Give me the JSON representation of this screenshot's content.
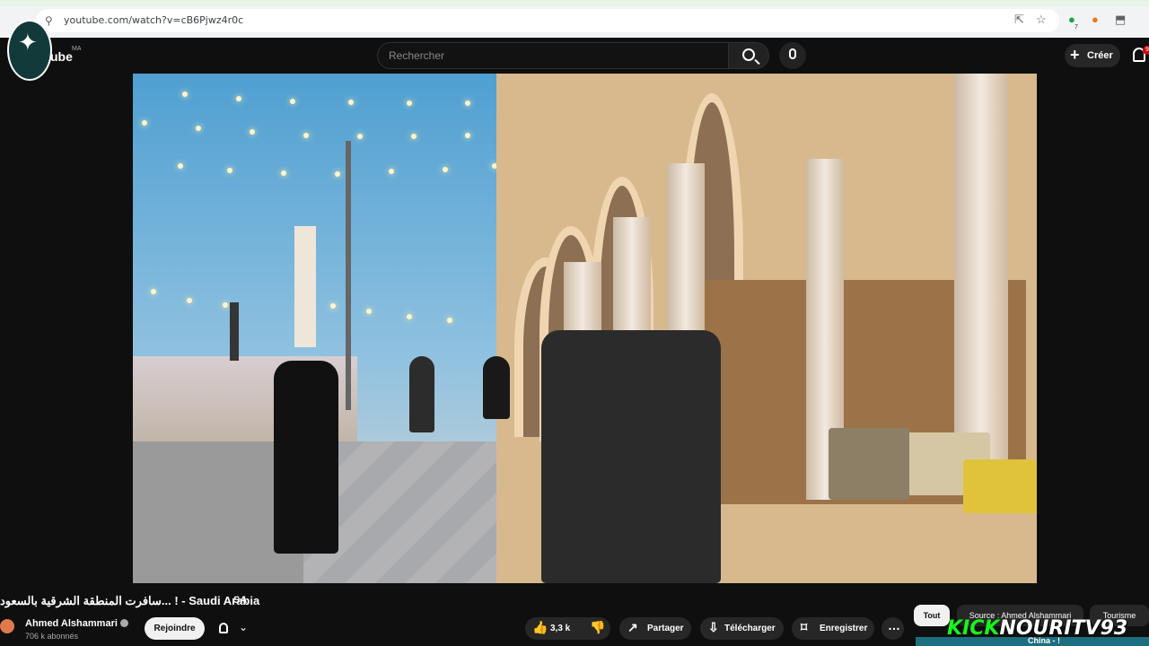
{
  "browser": {
    "url": "youtube.com/watch?v=cB6Pjwz4r0c",
    "notification_count": "7"
  },
  "header": {
    "logo_text": "ube",
    "country": "MA",
    "search_placeholder": "Rechercher",
    "create_label": "Créer",
    "notifications": "9"
  },
  "video": {
    "title": "سافرت المنطقة الشرقية بالسعود... ! - Saudi Arabia",
    "country_tag": "SA"
  },
  "channel": {
    "name": "Ahmed Alshammari",
    "subscribers": "706 k abonnés",
    "join_label": "Rejoindre"
  },
  "actions": {
    "likes": "3,3 k",
    "share": "Partager",
    "download": "Télécharger",
    "save": "Enregistrer"
  },
  "chips": [
    {
      "label": "Tout"
    },
    {
      "label": "Source : Ahmed Alshammari"
    },
    {
      "label": "Tourisme"
    }
  ],
  "overlay": {
    "kick": "KICK",
    "name": "NOURITV93",
    "caption": "China - !"
  },
  "colors": {
    "youtube_bg": "#0f0f0f",
    "kick_green": "#19f51b"
  }
}
